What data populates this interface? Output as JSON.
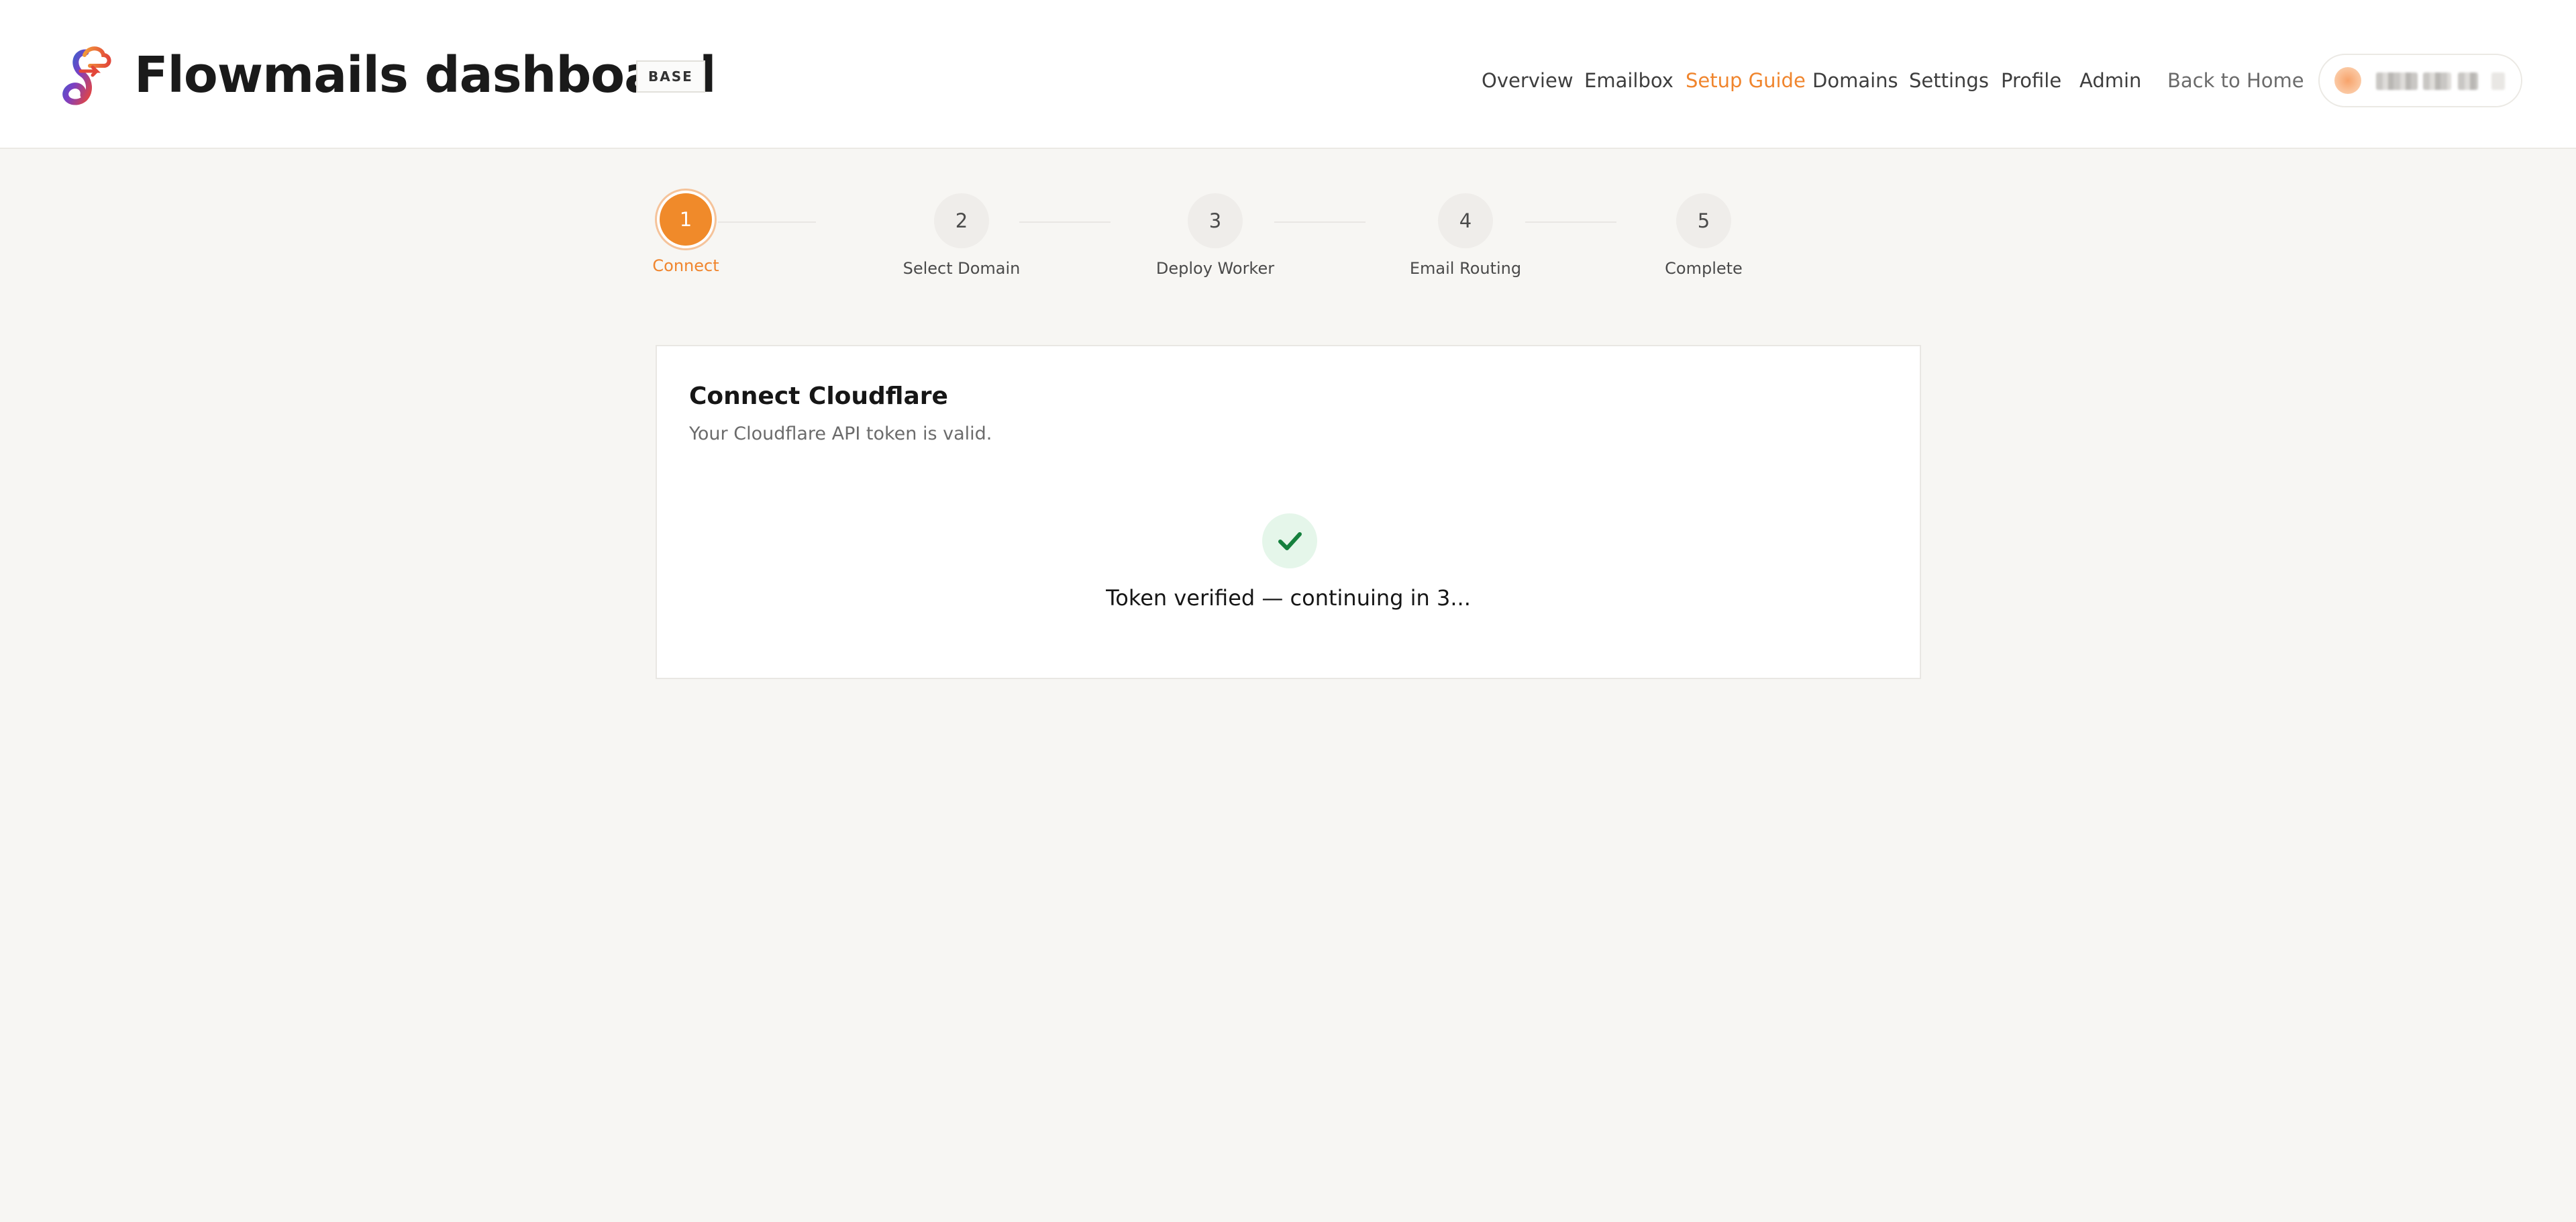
{
  "header": {
    "title": "Flowmails dashboard",
    "plan_badge": "BASE",
    "nav": {
      "overview": "Overview",
      "emailbox": "Emailbox",
      "setup_guide": "Setup Guide",
      "domains": "Domains",
      "settings": "Settings",
      "profile": "Profile",
      "admin": "Admin",
      "back_home": "Back to Home"
    },
    "active_nav": "Setup Guide",
    "accent_color": "#f0852d"
  },
  "stepper": {
    "current_step": 1,
    "steps": [
      {
        "number": "1",
        "label": "Connect"
      },
      {
        "number": "2",
        "label": "Select Domain"
      },
      {
        "number": "3",
        "label": "Deploy Worker"
      },
      {
        "number": "4",
        "label": "Email Routing"
      },
      {
        "number": "5",
        "label": "Complete"
      }
    ]
  },
  "card": {
    "title": "Connect Cloudflare",
    "subtitle": "Your Cloudflare API token is valid.",
    "status_icon": "check-icon",
    "status_text": "Token verified — continuing in 3..."
  }
}
